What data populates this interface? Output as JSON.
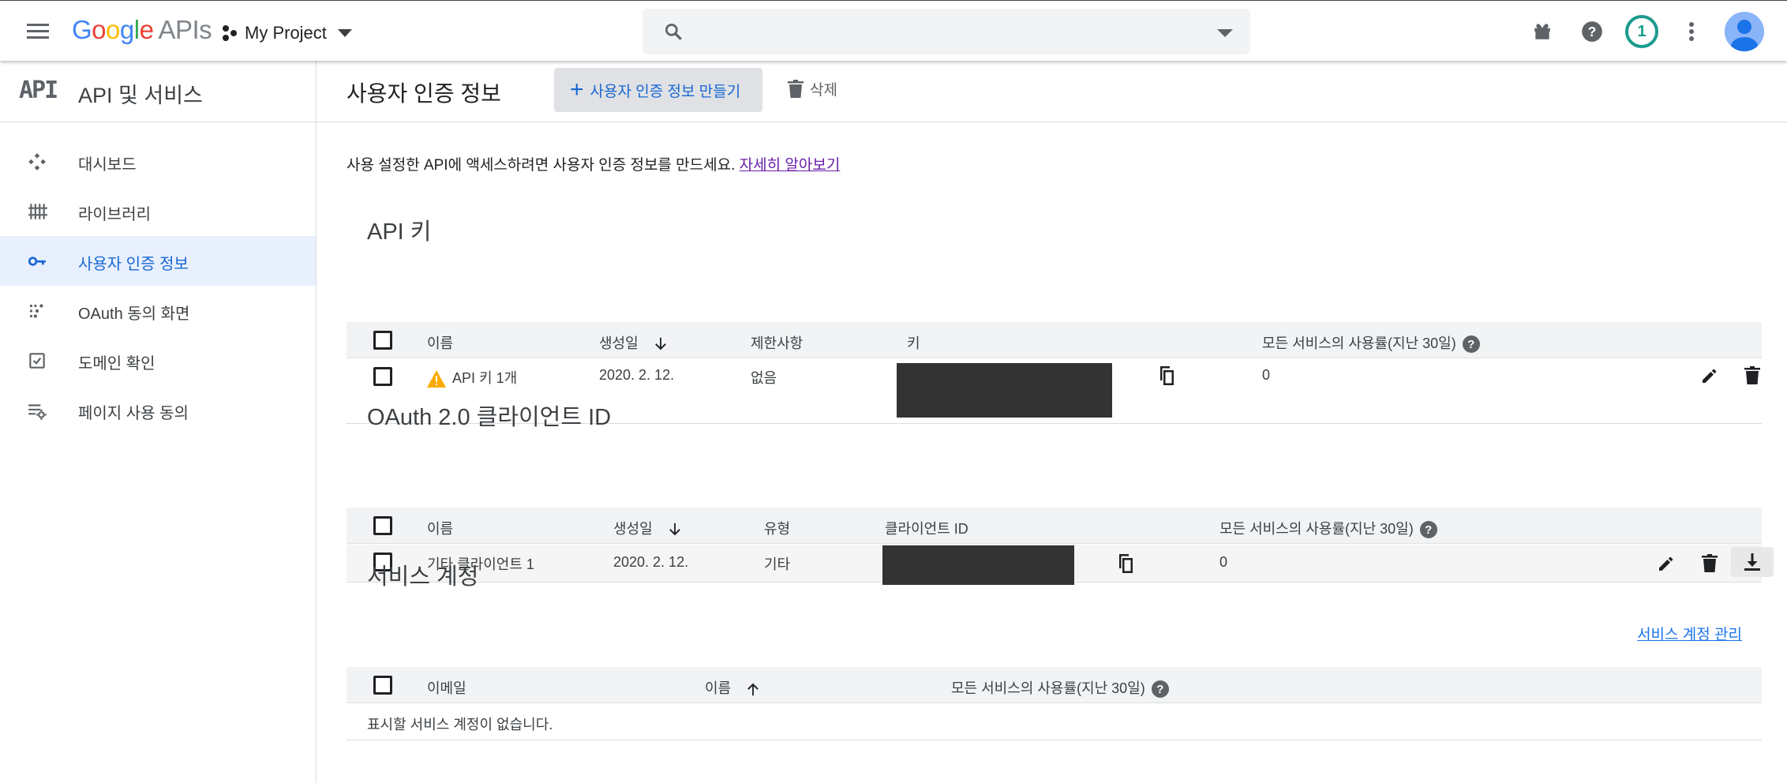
{
  "topbar": {
    "logo_google": "Google",
    "logo_apis": "APIs",
    "project_name": "My Project",
    "search_placeholder": "",
    "notification_count": "1"
  },
  "sidebar": {
    "logo_text": "API",
    "title": "API 및 서비스",
    "items": [
      {
        "label": "대시보드",
        "icon": "dashboard-icon"
      },
      {
        "label": "라이브러리",
        "icon": "library-icon"
      },
      {
        "label": "사용자 인증 정보",
        "icon": "key-icon",
        "active": true
      },
      {
        "label": "OAuth 동의 화면",
        "icon": "oauth-consent-icon"
      },
      {
        "label": "도메인 확인",
        "icon": "domain-check-icon"
      },
      {
        "label": "페이지 사용 동의",
        "icon": "page-usage-icon"
      }
    ]
  },
  "main": {
    "title": "사용자 인증 정보",
    "create_label": "사용자 인증 정보 만들기",
    "delete_label": "삭제",
    "description": "사용 설정한 API에 액세스하려면 사용자 인증 정보를 만드세요.",
    "learn_more": "자세히 알아보기"
  },
  "api_keys": {
    "title": "API 키",
    "headers": [
      "이름",
      "생성일",
      "제한사항",
      "키",
      "모든 서비스의 사용률(지난 30일)"
    ],
    "rows": [
      {
        "name": "API 키 1개",
        "created": "2020. 2. 12.",
        "restriction": "없음",
        "usage": "0"
      }
    ]
  },
  "oauth": {
    "title": "OAuth 2.0 클라이언트 ID",
    "headers": [
      "이름",
      "생성일",
      "유형",
      "클라이언트 ID",
      "모든 서비스의 사용률(지난 30일)"
    ],
    "rows": [
      {
        "name": "기타 클라이언트 1",
        "created": "2020. 2. 12.",
        "type": "기타",
        "usage": "0"
      }
    ]
  },
  "service_accounts": {
    "title": "서비스 계정",
    "manage_link": "서비스 계정 관리",
    "headers": [
      "이메일",
      "이름",
      "모든 서비스의 사용률(지난 30일)"
    ],
    "empty_message": "표시할 서비스 계정이 없습니다."
  },
  "colors": {
    "accent": "#1967d2",
    "active_bg": "#e8f0fe",
    "warning": "#f9ab00",
    "badge": "#1a9c8f"
  }
}
